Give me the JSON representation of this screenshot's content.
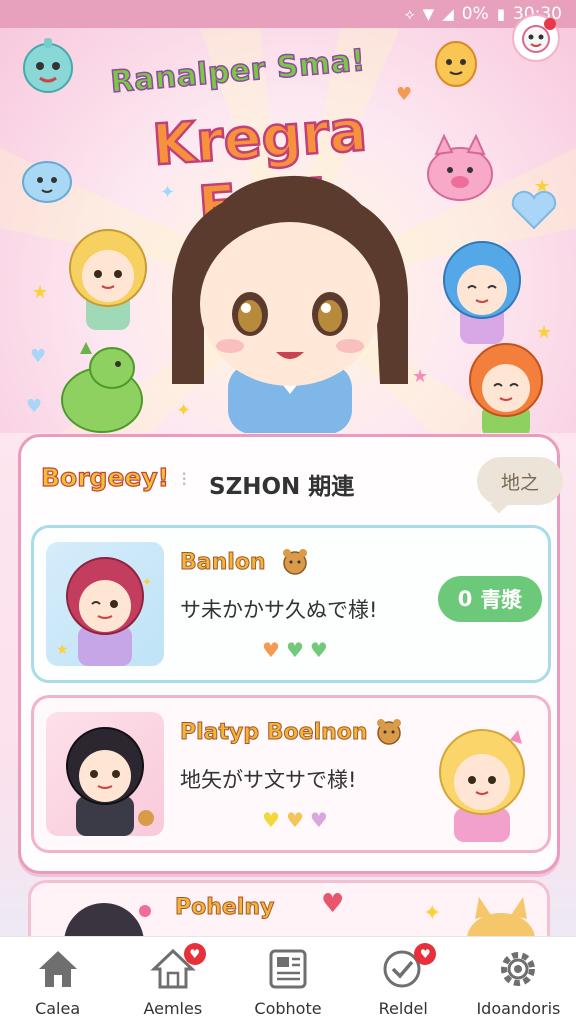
{
  "status_bar": {
    "battery_text": "0%",
    "time": "30:30"
  },
  "hero": {
    "subtitle": "Ranalper Sma!",
    "title": "Kregra Fas!"
  },
  "panel": {
    "badge": "Borgeey!",
    "separator": "⁝",
    "title": "SZHON 期連",
    "pill_label": "地之"
  },
  "cards": [
    {
      "name": "Banlon",
      "text": "サ未かかサ久ぬで様!",
      "hearts": [
        "#f59a52",
        "#73c97a",
        "#73c97a"
      ],
      "action_label": "青漿",
      "action_count": "0"
    },
    {
      "name": "Platyp Boelnon",
      "text": "地矢がサ文サで様!",
      "hearts": [
        "#f2d83a",
        "#f2c45a",
        "#d9a7e0"
      ]
    }
  ],
  "peek_card": {
    "name": "Pohelny"
  },
  "bottom_nav": [
    {
      "label": "Calea",
      "icon": "home-icon",
      "badge": false
    },
    {
      "label": "Aemles",
      "icon": "house-outline-icon",
      "badge": true
    },
    {
      "label": "Cobhote",
      "icon": "news-icon",
      "badge": false
    },
    {
      "label": "Reldel",
      "icon": "check-circle-icon",
      "badge": true
    },
    {
      "label": "Idoandoris",
      "icon": "settings-icon",
      "badge": false
    }
  ],
  "colors": {
    "accent_pink": "#ea9cbe",
    "action_green": "#6cc97a",
    "badge_red": "#e8303b"
  }
}
